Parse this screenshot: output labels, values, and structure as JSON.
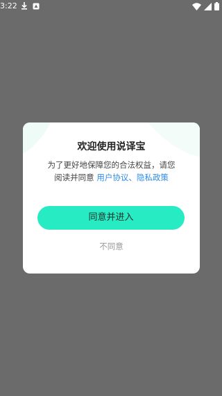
{
  "status_bar": {
    "time": "3:22",
    "icons": [
      "download-icon",
      "notification-icon",
      "wifi-icon",
      "signal-icon",
      "battery-icon"
    ]
  },
  "dialog": {
    "title": "欢迎使用说译宝",
    "message_line1": "为了更好地保障您的合法权益，请您",
    "message_line2_prefix": "阅读并同意 ",
    "user_agreement_link": "用户协议",
    "separator": "、",
    "privacy_policy_link": "隐私政策",
    "agree_button": "同意并进入",
    "disagree_button": "不同意"
  },
  "colors": {
    "overlay": "#6b6b6b",
    "accent": "#27ecc3",
    "link": "#2f8ee8",
    "decor": "#e6f8f3"
  }
}
